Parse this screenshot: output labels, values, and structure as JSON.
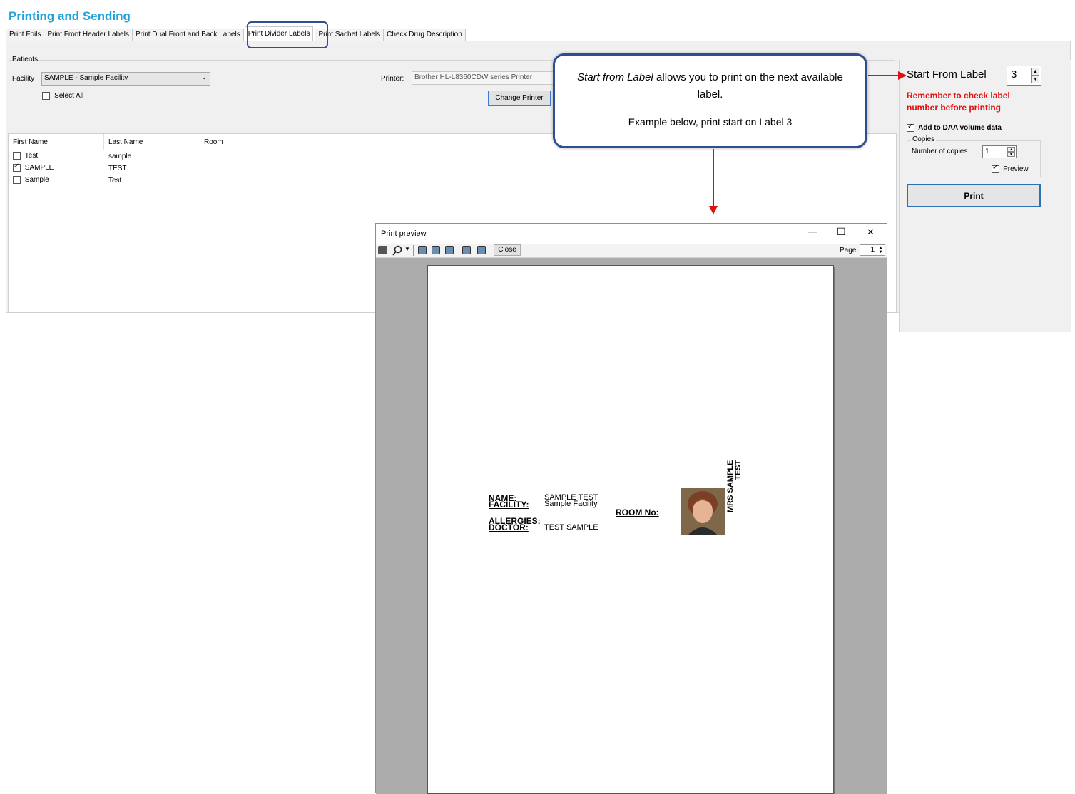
{
  "app_title": "Printing and Sending",
  "tabs": [
    "Print Foils",
    "Print Front Header Labels",
    "Print Dual Front and Back Labels",
    "Print Divider Labels",
    "Print Sachet Labels",
    "Check Drug Description"
  ],
  "patients_section": "Patients",
  "facility_label": "Facility",
  "facility_value": "SAMPLE - Sample Facility",
  "select_all": "Select All",
  "printer_label": "Printer:",
  "printer_value": "Brother HL-L8360CDW series Printer",
  "change_printer": "Change Printer",
  "columns": [
    "First Name",
    "Last Name",
    "Room"
  ],
  "patients": [
    {
      "first": "Test",
      "last": "sample",
      "checked": false
    },
    {
      "first": "SAMPLE",
      "last": "TEST",
      "checked": true
    },
    {
      "first": "Sample",
      "last": "Test",
      "checked": false
    }
  ],
  "callout": {
    "italic": "Start from Label",
    "rest": " allows you to print on the next available label.",
    "example": "Example below, print start on Label 3"
  },
  "start_from_label": "Start From Label",
  "start_value": "3",
  "warning": "Remember to check label number before printing",
  "add_daa": "Add to DAA volume data",
  "copies_group": "Copies",
  "number_of_copies": "Number of copies",
  "copies_value": "1",
  "preview_label": "Preview",
  "print_button": "Print",
  "preview_window": {
    "title": "Print preview",
    "close_btn": "Close",
    "page_label": "Page",
    "page_value": "1",
    "min_glyph": "—",
    "max_glyph": "☐",
    "close_glyph": "✕"
  },
  "label_content": {
    "name_label": "NAME:",
    "name_value": "SAMPLE TEST",
    "facility_label": "FACILITY:",
    "facility_value": "Sample Facility",
    "allergies_label": "ALLERGIES:",
    "doctor_label": "DOCTOR:",
    "doctor_value": "TEST SAMPLE",
    "room_label": "ROOM No:",
    "vertical_name_1": "MRS SAMPLE",
    "vertical_name_2": "TEST"
  },
  "colors": {
    "title": "#1fa3d8",
    "callout_border": "#2c4f8f",
    "arrow": "#e01010",
    "warning": "#e01010",
    "print_border": "#2f6fb5"
  }
}
